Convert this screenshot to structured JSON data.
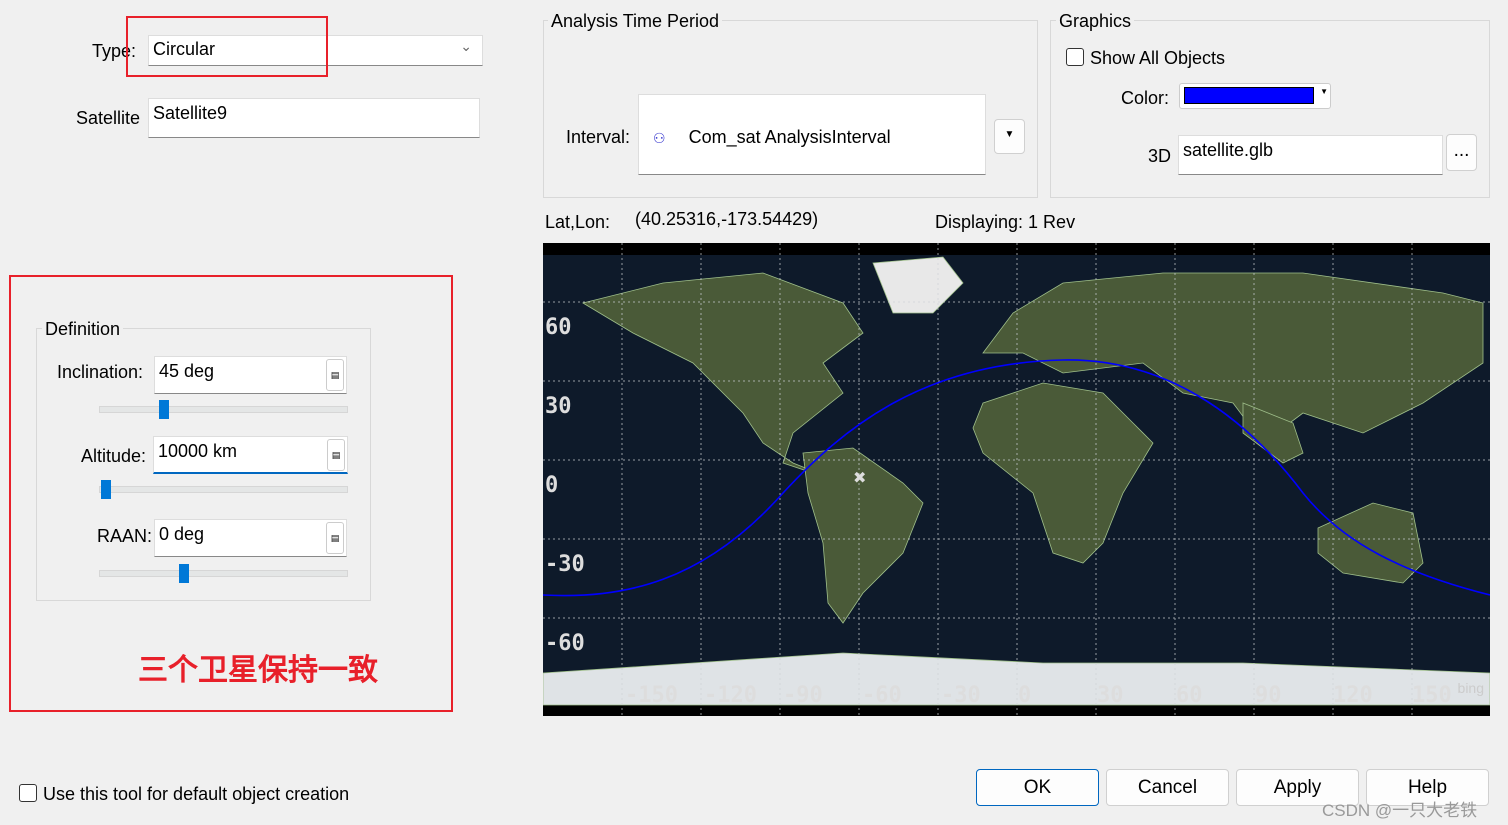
{
  "type": {
    "label": "Type:",
    "value": "Circular"
  },
  "satellite": {
    "label": "Satellite",
    "value": "Satellite9"
  },
  "definition": {
    "title": "Definition",
    "inclination": {
      "label": "Inclination:",
      "value": "45 deg",
      "slider_fraction": 0.25
    },
    "altitude": {
      "label": "Altitude:",
      "value": "10000 km",
      "slider_fraction": 0.0
    },
    "raan": {
      "label": "RAAN:",
      "value": "0 deg",
      "slider_fraction": 0.34
    }
  },
  "annotation": "三个卫星保持一致",
  "analysis": {
    "title": "Analysis Time Period",
    "interval_label": "Interval:",
    "interval_value": "Com_sat AnalysisInterval"
  },
  "graphics": {
    "title": "Graphics",
    "show_all": "Show All Objects",
    "color_label": "Color:",
    "color": "#0000ff",
    "model_label": "3D",
    "model_value": "satellite.glb",
    "browse": "..."
  },
  "status": {
    "latlon_label": "Lat,Lon:",
    "latlon_value": "(40.25316,-173.54429)",
    "displaying": "Displaying: 1 Rev"
  },
  "map": {
    "lat_labels": [
      "60",
      "30",
      "0",
      "-30",
      "-60"
    ],
    "lon_labels": [
      "-150",
      "-120",
      "-90",
      "-60",
      "-30",
      "0",
      "30",
      "60",
      "90",
      "120",
      "150"
    ],
    "watermark": "bing",
    "track_color": "#0000ff"
  },
  "default_tool": "Use this tool for default object creation",
  "buttons": {
    "ok": "OK",
    "cancel": "Cancel",
    "apply": "Apply",
    "help": "Help"
  },
  "csdn": "CSDN @一只大老铁"
}
